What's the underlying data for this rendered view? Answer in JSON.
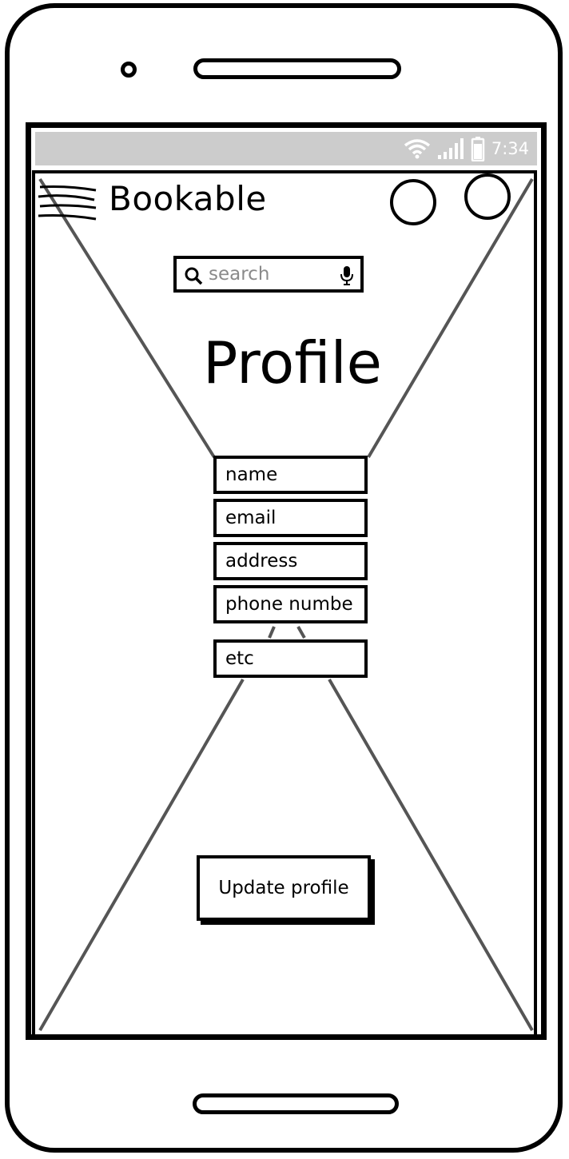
{
  "status_bar": {
    "time": "7:34"
  },
  "header": {
    "app_title": "Bookable"
  },
  "search": {
    "placeholder": "search"
  },
  "page": {
    "title": "Profile"
  },
  "form": {
    "fields": [
      {
        "label": "name"
      },
      {
        "label": "email"
      },
      {
        "label": "address"
      },
      {
        "label": "phone numbe"
      },
      {
        "label": "etc"
      }
    ]
  },
  "actions": {
    "update_label": "Update profile"
  },
  "icons": [
    "wifi-icon",
    "signal-icon",
    "battery-icon",
    "menu-icon",
    "search-icon",
    "microphone-icon"
  ],
  "colors": {
    "status_bar_bg": "#cccccc",
    "outline": "#000000",
    "placeholder_lines": "#555555"
  }
}
